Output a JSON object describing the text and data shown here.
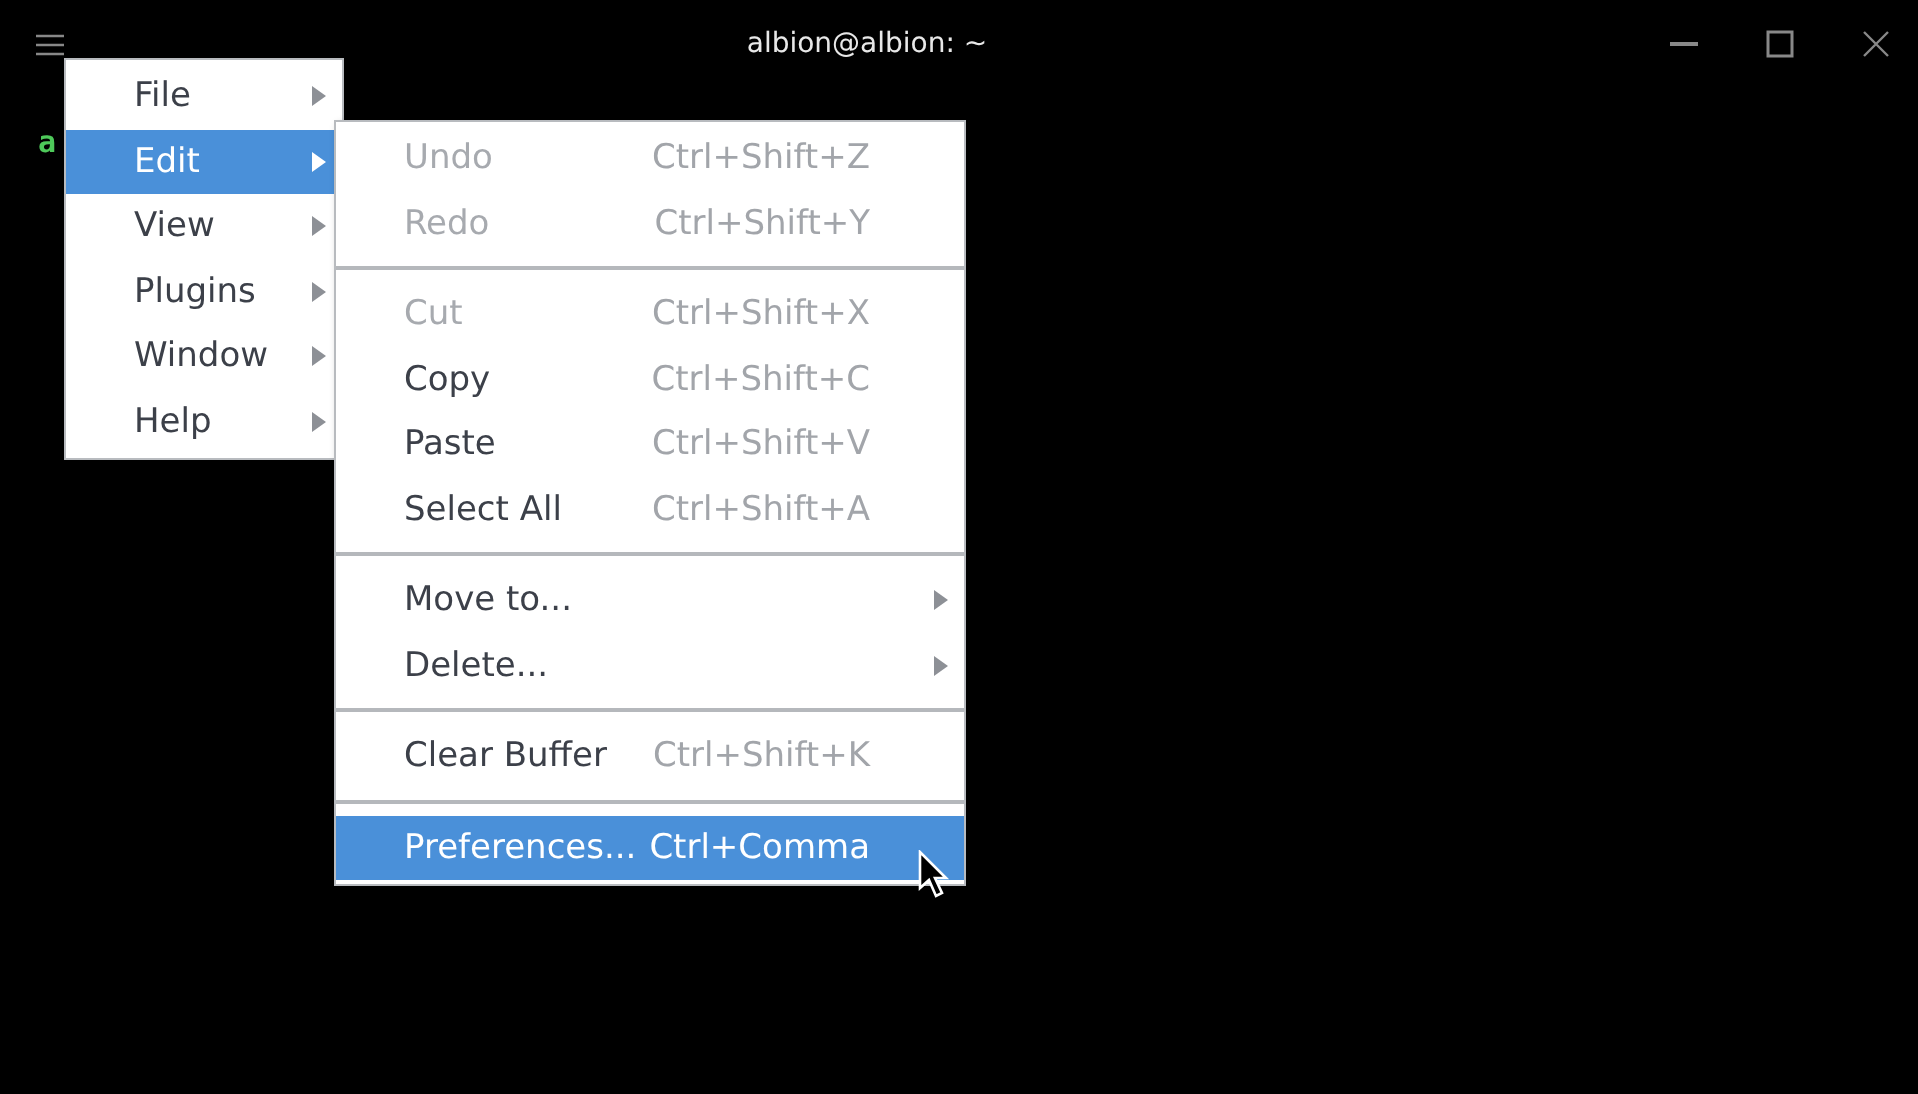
{
  "window": {
    "title": "albion@albion: ~"
  },
  "terminal": {
    "text": "a"
  },
  "menu": {
    "items": [
      {
        "label": "File",
        "selected": false
      },
      {
        "label": "Edit",
        "selected": true
      },
      {
        "label": "View",
        "selected": false
      },
      {
        "label": "Plugins",
        "selected": false
      },
      {
        "label": "Window",
        "selected": false
      },
      {
        "label": "Help",
        "selected": false
      }
    ]
  },
  "submenu": {
    "items": [
      {
        "kind": "item",
        "label": "Undo",
        "shortcut": "Ctrl+Shift+Z",
        "disabled": true,
        "selected": false,
        "has_submenu": false
      },
      {
        "kind": "item",
        "label": "Redo",
        "shortcut": "Ctrl+Shift+Y",
        "disabled": true,
        "selected": false,
        "has_submenu": false
      },
      {
        "kind": "separator"
      },
      {
        "kind": "item",
        "label": "Cut",
        "shortcut": "Ctrl+Shift+X",
        "disabled": true,
        "selected": false,
        "has_submenu": false
      },
      {
        "kind": "item",
        "label": "Copy",
        "shortcut": "Ctrl+Shift+C",
        "disabled": false,
        "selected": false,
        "has_submenu": false
      },
      {
        "kind": "item",
        "label": "Paste",
        "shortcut": "Ctrl+Shift+V",
        "disabled": false,
        "selected": false,
        "has_submenu": false
      },
      {
        "kind": "item",
        "label": "Select All",
        "shortcut": "Ctrl+Shift+A",
        "disabled": false,
        "selected": false,
        "has_submenu": false
      },
      {
        "kind": "separator"
      },
      {
        "kind": "item",
        "label": "Move to...",
        "disabled": false,
        "selected": false,
        "has_submenu": true
      },
      {
        "kind": "item",
        "label": "Delete...",
        "disabled": false,
        "selected": false,
        "has_submenu": true
      },
      {
        "kind": "separator"
      },
      {
        "kind": "item",
        "label": "Clear Buffer",
        "shortcut": "Ctrl+Shift+K",
        "disabled": false,
        "selected": false,
        "has_submenu": false
      },
      {
        "kind": "separator"
      },
      {
        "kind": "item",
        "label": "Preferences...",
        "shortcut": "Ctrl+Comma",
        "disabled": false,
        "selected": true,
        "has_submenu": false
      }
    ]
  }
}
